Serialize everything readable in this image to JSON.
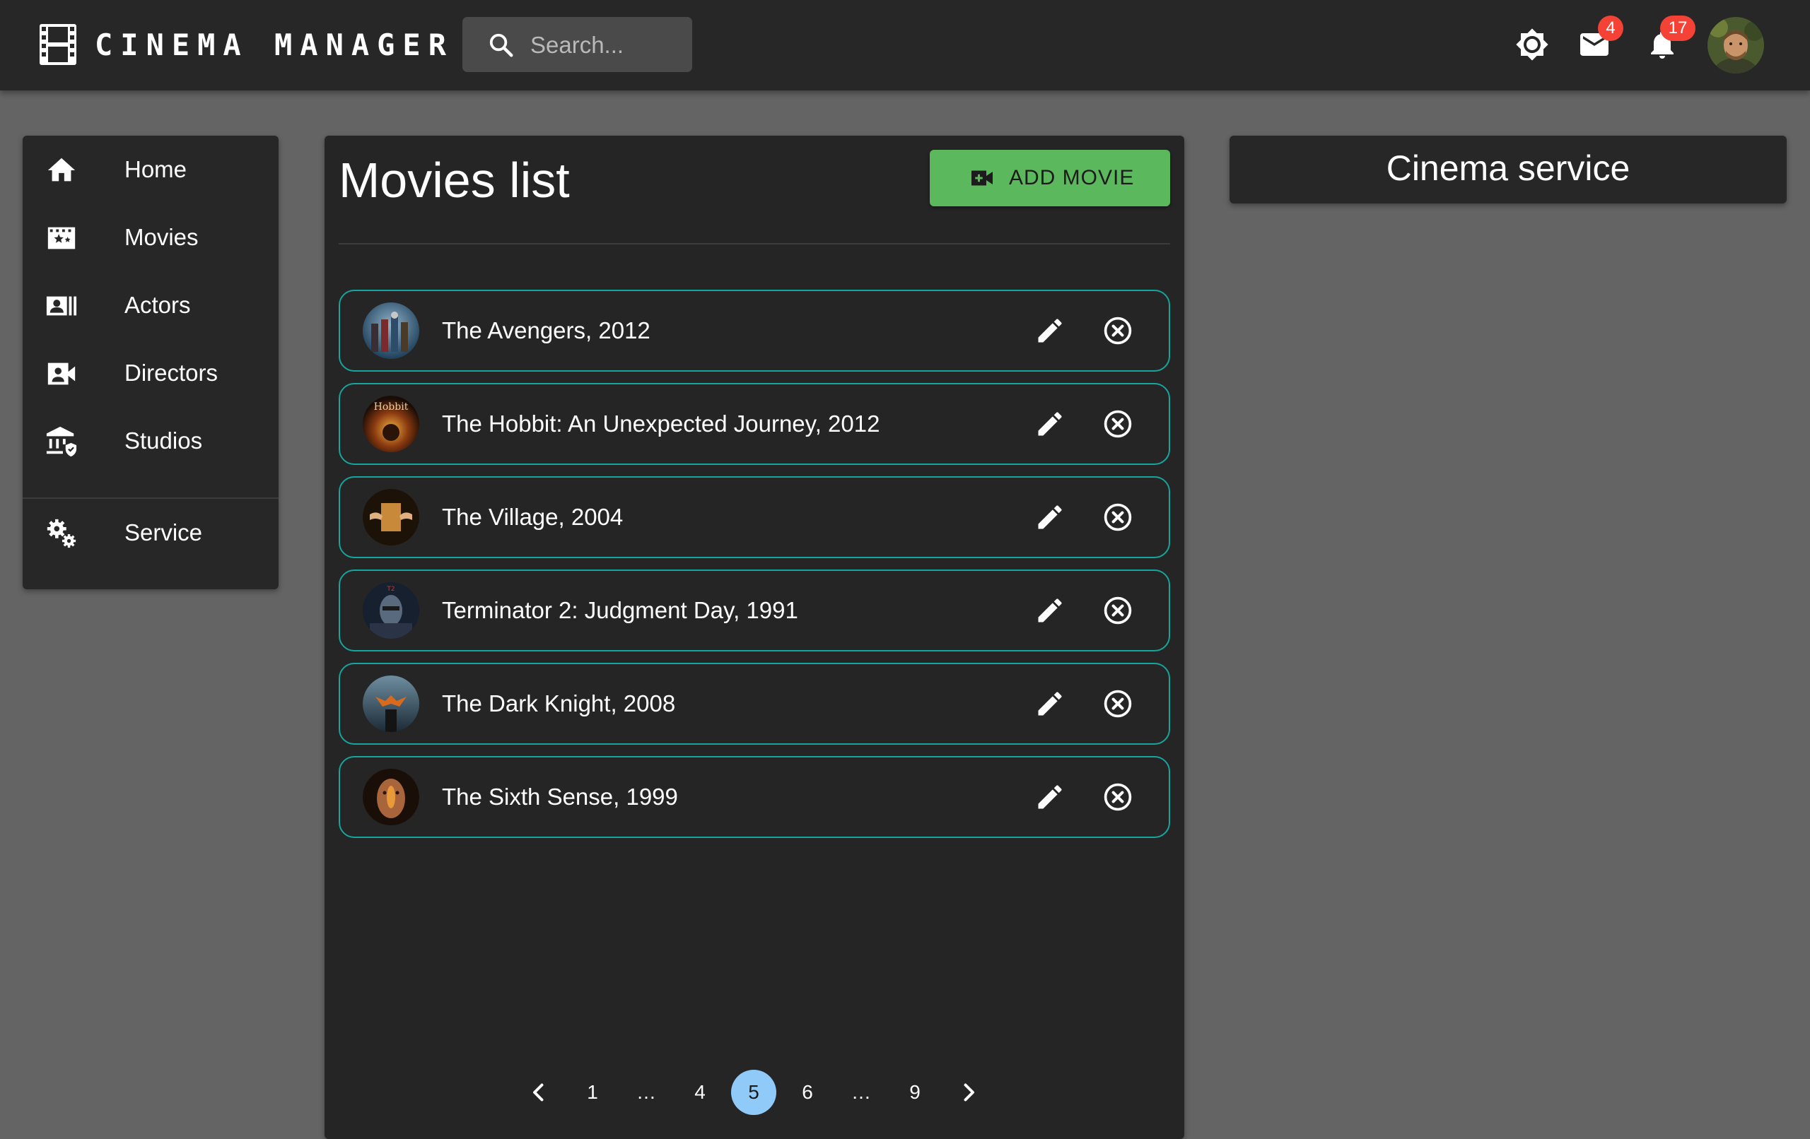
{
  "header": {
    "brand_title": "CINEMA MANAGER",
    "search_placeholder": "Search...",
    "mail_badge": "4",
    "notifications_badge": "17",
    "icons": [
      "film-icon",
      "search-icon",
      "brightness-icon",
      "mail-icon",
      "bell-icon",
      "avatar"
    ]
  },
  "sidebar": {
    "items": [
      {
        "label": "Home",
        "icon": "home-icon"
      },
      {
        "label": "Movies",
        "icon": "movie-icon"
      },
      {
        "label": "Actors",
        "icon": "contacts-icon"
      },
      {
        "label": "Directors",
        "icon": "video-camera-user-icon"
      },
      {
        "label": "Studios",
        "icon": "building-shield-icon"
      },
      {
        "label": "Service",
        "icon": "gears-icon"
      }
    ]
  },
  "main": {
    "title": "Movies list",
    "add_button_label": "ADD MOVIE",
    "movies": [
      {
        "title": "The Avengers, 2012"
      },
      {
        "title": "The Hobbit: An Unexpected Journey, 2012"
      },
      {
        "title": "The Village, 2004"
      },
      {
        "title": "Terminator 2: Judgment Day, 1991"
      },
      {
        "title": "The Dark Knight, 2008"
      },
      {
        "title": "The Sixth Sense, 1999"
      }
    ],
    "pagination": {
      "pages": [
        "1",
        "…",
        "4",
        "5",
        "6",
        "…",
        "9"
      ],
      "current": "5"
    }
  },
  "service_card": {
    "title": "Cinema service"
  },
  "colors": {
    "topbar": "#272727",
    "background": "#646464",
    "panel": "#252525",
    "accent_border": "#15a59d",
    "add_button": "#5cb85c",
    "active_page": "#90caf9",
    "badge": "#f44336"
  }
}
